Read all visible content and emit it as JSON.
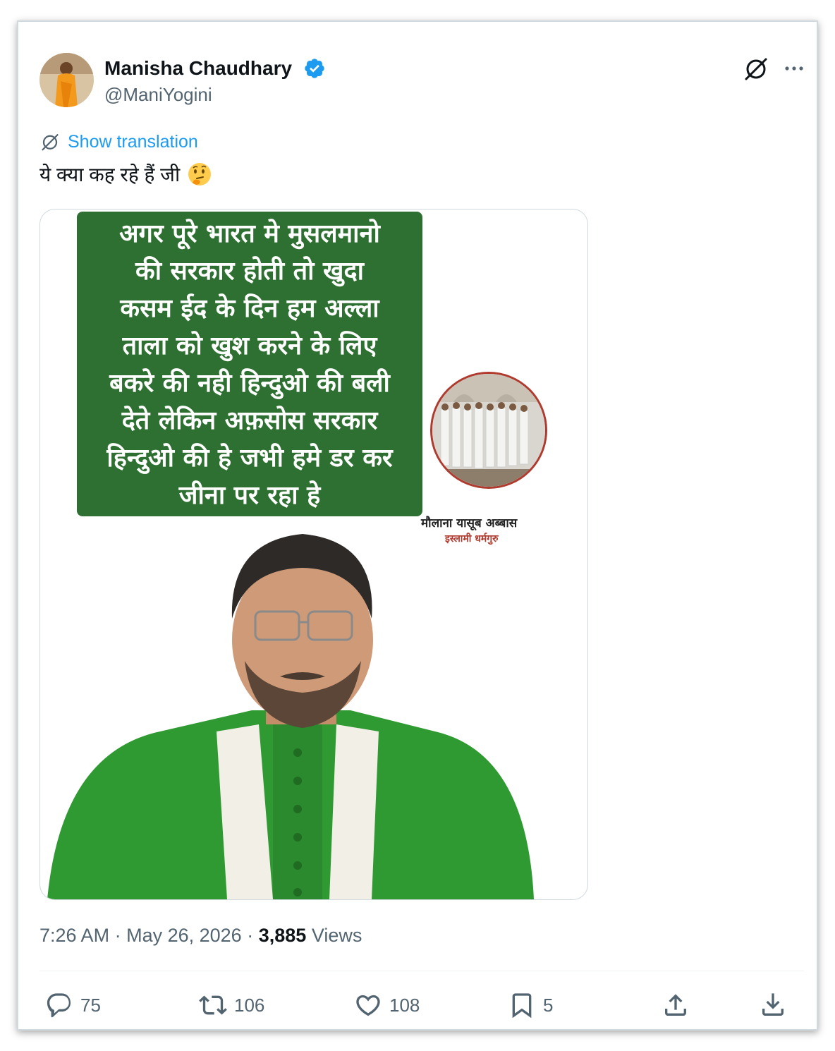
{
  "author": {
    "name": "Manisha Chaudhary",
    "handle": "@ManiYogini",
    "verified": true,
    "avatar_icon": "avatar-woman-orange-saree"
  },
  "header_icons": [
    "grok-icon",
    "more-icon"
  ],
  "translation_link": "Show translation",
  "tweet_text": "ये क्या कह रहे हैं जी",
  "tweet_emoji": "thinking-face-icon",
  "media": {
    "green_box_lines": [
      "अगर पूरे भारत मे मुसलमानो",
      "की सरकार होती तो खुदा",
      "कसम ईद के दिन हम अल्ला",
      "ताला को खुश करने के लिए",
      "बकरे की नही हिन्दुओ की बली",
      "देते लेकिन अफ़सोस सरकार",
      "हिन्दुओ की हे जभी हमे डर कर",
      "जीना पर रहा हे"
    ],
    "caption_name": "मौलाना यासूब अब्बास",
    "caption_title": "इस्लामी धर्मगुरु",
    "colors": {
      "banner": "#2e7032",
      "robe": "#2f9a32",
      "scarf": "#f1efe6"
    }
  },
  "meta": {
    "time": "7:26 AM",
    "separator": "·",
    "date": "May 26, 2026",
    "views_count": "3,885",
    "views_label": "Views"
  },
  "actions": {
    "replies": "75",
    "reposts": "106",
    "likes": "108",
    "bookmarks": "5"
  },
  "colors": {
    "accent": "#1d9bf0",
    "secondary_text": "#536471",
    "primary_text": "#0f1419"
  }
}
